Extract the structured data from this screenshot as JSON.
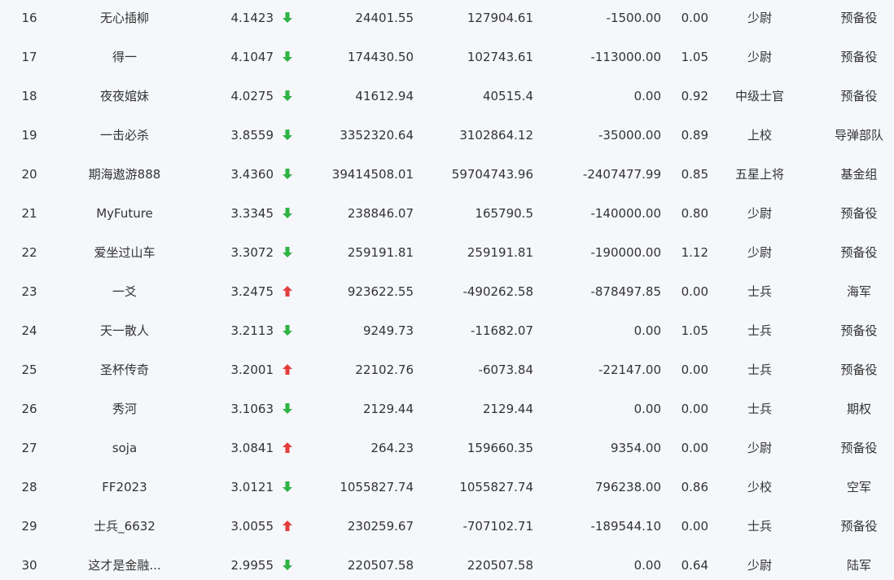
{
  "colors": {
    "down": "#2fb344",
    "up": "#e43d3d",
    "background": "#f5f7fa",
    "text": "#333333"
  },
  "rows": [
    {
      "rank": "16",
      "name": "无心插柳",
      "score": "4.1423",
      "trend": "down",
      "v1": "24401.55",
      "v2": "127904.61",
      "v3": "-1500.00",
      "ratio": "0.00",
      "rank_title": "少尉",
      "group": "预备役"
    },
    {
      "rank": "17",
      "name": "得一",
      "score": "4.1047",
      "trend": "down",
      "v1": "174430.50",
      "v2": "102743.61",
      "v3": "-113000.00",
      "ratio": "1.05",
      "rank_title": "少尉",
      "group": "预备役"
    },
    {
      "rank": "18",
      "name": "夜夜婠妹",
      "score": "4.0275",
      "trend": "down",
      "v1": "41612.94",
      "v2": "40515.4",
      "v3": "0.00",
      "ratio": "0.92",
      "rank_title": "中级士官",
      "group": "预备役"
    },
    {
      "rank": "19",
      "name": "一击必杀",
      "score": "3.8559",
      "trend": "down",
      "v1": "3352320.64",
      "v2": "3102864.12",
      "v3": "-35000.00",
      "ratio": "0.89",
      "rank_title": "上校",
      "group": "导弹部队"
    },
    {
      "rank": "20",
      "name": "期海遨游888",
      "score": "3.4360",
      "trend": "down",
      "v1": "39414508.01",
      "v2": "59704743.96",
      "v3": "-2407477.99",
      "ratio": "0.85",
      "rank_title": "五星上将",
      "group": "基金组"
    },
    {
      "rank": "21",
      "name": "MyFuture",
      "score": "3.3345",
      "trend": "down",
      "v1": "238846.07",
      "v2": "165790.5",
      "v3": "-140000.00",
      "ratio": "0.80",
      "rank_title": "少尉",
      "group": "预备役"
    },
    {
      "rank": "22",
      "name": "爱坐过山车",
      "score": "3.3072",
      "trend": "down",
      "v1": "259191.81",
      "v2": "259191.81",
      "v3": "-190000.00",
      "ratio": "1.12",
      "rank_title": "少尉",
      "group": "预备役"
    },
    {
      "rank": "23",
      "name": "一爻",
      "score": "3.2475",
      "trend": "up",
      "v1": "923622.55",
      "v2": "-490262.58",
      "v3": "-878497.85",
      "ratio": "0.00",
      "rank_title": "士兵",
      "group": "海军"
    },
    {
      "rank": "24",
      "name": "天一散人",
      "score": "3.2113",
      "trend": "down",
      "v1": "9249.73",
      "v2": "-11682.07",
      "v3": "0.00",
      "ratio": "1.05",
      "rank_title": "士兵",
      "group": "预备役"
    },
    {
      "rank": "25",
      "name": "圣杯传奇",
      "score": "3.2001",
      "trend": "up",
      "v1": "22102.76",
      "v2": "-6073.84",
      "v3": "-22147.00",
      "ratio": "0.00",
      "rank_title": "士兵",
      "group": "预备役"
    },
    {
      "rank": "26",
      "name": "秀河",
      "score": "3.1063",
      "trend": "down",
      "v1": "2129.44",
      "v2": "2129.44",
      "v3": "0.00",
      "ratio": "0.00",
      "rank_title": "士兵",
      "group": "期权"
    },
    {
      "rank": "27",
      "name": "soja",
      "score": "3.0841",
      "trend": "up",
      "v1": "264.23",
      "v2": "159660.35",
      "v3": "9354.00",
      "ratio": "0.00",
      "rank_title": "少尉",
      "group": "预备役"
    },
    {
      "rank": "28",
      "name": "FF2023",
      "score": "3.0121",
      "trend": "down",
      "v1": "1055827.74",
      "v2": "1055827.74",
      "v3": "796238.00",
      "ratio": "0.86",
      "rank_title": "少校",
      "group": "空军"
    },
    {
      "rank": "29",
      "name": "士兵_6632",
      "score": "3.0055",
      "trend": "up",
      "v1": "230259.67",
      "v2": "-707102.71",
      "v3": "-189544.10",
      "ratio": "0.00",
      "rank_title": "士兵",
      "group": "预备役"
    },
    {
      "rank": "30",
      "name": "这才是金融...",
      "score": "2.9955",
      "trend": "down",
      "v1": "220507.58",
      "v2": "220507.58",
      "v3": "0.00",
      "ratio": "0.64",
      "rank_title": "少尉",
      "group": "陆军"
    }
  ]
}
